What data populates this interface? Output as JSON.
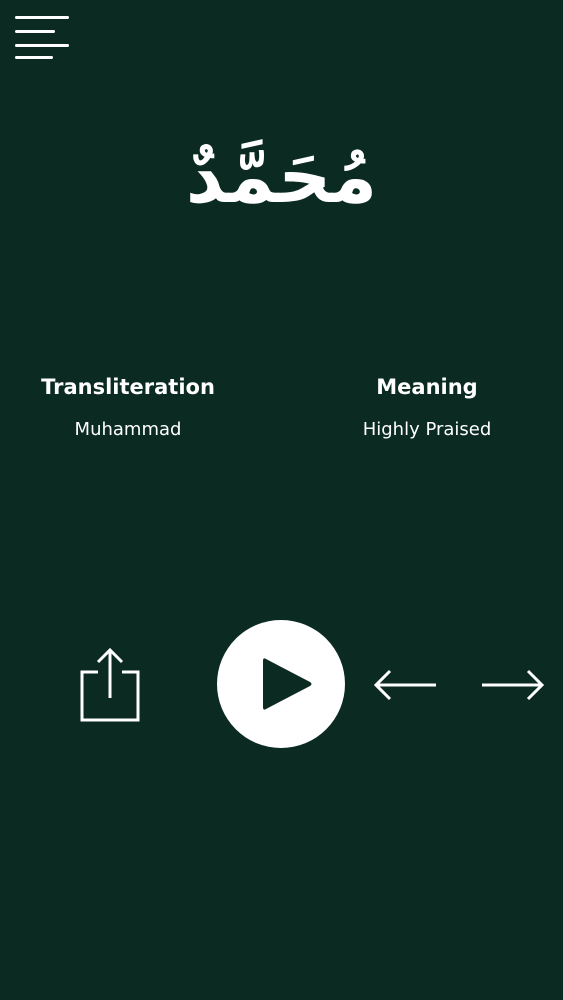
{
  "name": {
    "arabic": "مُحَمَّدٌ"
  },
  "details": {
    "transliteration_label": "Transliteration",
    "transliteration_value": "Muhammad",
    "meaning_label": "Meaning",
    "meaning_value": "Highly Praised"
  },
  "controls": {
    "menu_icon": "hamburger-menu-icon",
    "share_icon": "share-icon",
    "play_icon": "play-icon",
    "previous_icon": "arrow-left-icon",
    "next_icon": "arrow-right-icon"
  },
  "theme": {
    "background": "#0b2a21",
    "foreground": "#ffffff"
  }
}
